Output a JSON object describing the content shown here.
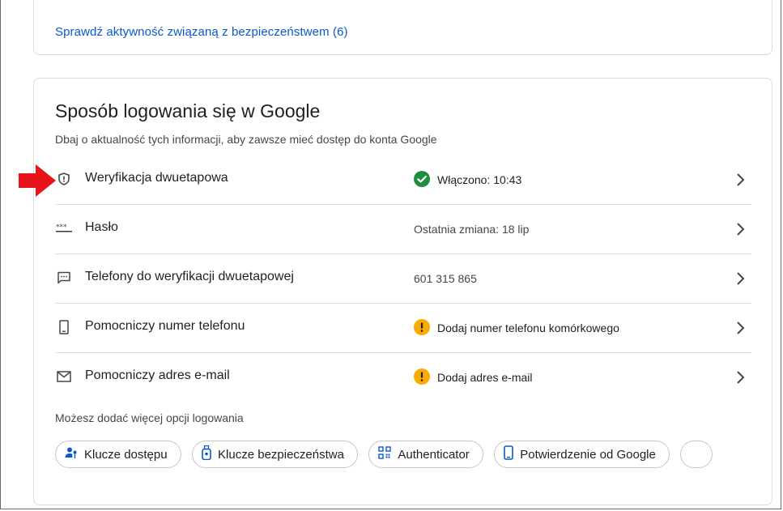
{
  "activity": {
    "link_label": "Sprawdź aktywność związaną z bezpieczeństwem (6)"
  },
  "signin": {
    "title": "Sposób logowania się w Google",
    "subtitle": "Dbaj o aktualność tych informacji, aby zawsze mieć dostęp do konta Google",
    "rows": [
      {
        "label": "Weryfikacja dwuetapowa",
        "status": "Włączono: 10:43",
        "icon": "shield-icon",
        "status_icon": "check-circle-icon"
      },
      {
        "label": "Hasło",
        "status": "Ostatnia zmiana: 18 lip",
        "icon": "password-dots-icon"
      },
      {
        "label": "Telefony do weryfikacji dwuetapowej",
        "status": "601 315 865",
        "icon": "message-icon"
      },
      {
        "label": "Pomocniczy numer telefonu",
        "status": "Dodaj numer telefonu komórkowego",
        "icon": "phone-icon",
        "status_icon": "warning-icon"
      },
      {
        "label": "Pomocniczy adres e-mail",
        "status": "Dodaj adres e-mail",
        "icon": "mail-icon",
        "status_icon": "warning-icon"
      }
    ],
    "more_options_text": "Możesz dodać więcej opcji logowania",
    "chips": [
      {
        "label": "Klucze dostępu",
        "icon": "passkey-icon"
      },
      {
        "label": "Klucze bezpieczeństwa",
        "icon": "security-key-icon"
      },
      {
        "label": "Authenticator",
        "icon": "qr-code-icon"
      },
      {
        "label": "Potwierdzenie od Google",
        "icon": "smartphone-icon"
      }
    ]
  },
  "colors": {
    "link": "#0b57d0",
    "success": "#1e8e3e",
    "warning": "#f9ab00",
    "annotation_arrow": "#e8141c"
  }
}
